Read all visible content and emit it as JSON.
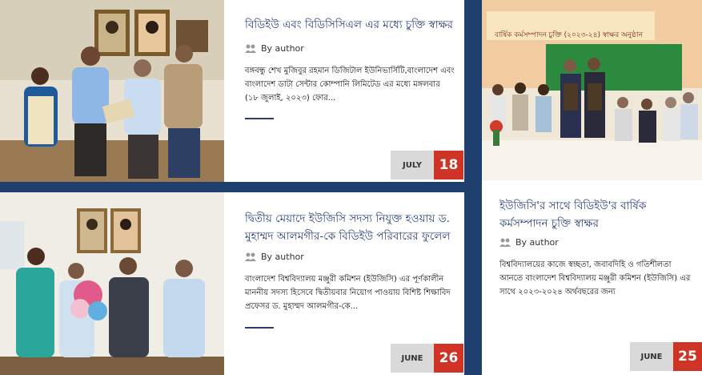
{
  "posts": [
    {
      "title": "বিডিইউ এবং বিডিসিসিএল এর মধ্যে চুক্তি স্বাক্ষর",
      "author": "By author",
      "excerpt": "বঙ্গবন্ধু শেখ মুজিবুর রহমান ডিজিটাল ইউনিভার্সিটি,বাংলাদেশ এবং বাংলাদেশ ডাটা সেন্টার কোম্পানি লিমিটেড এর মধ্যে মঙ্গলবার (১৮ জুলাই, ২০২৩) ফোর...",
      "month": "JULY",
      "day": "18"
    },
    {
      "banner_line": "বার্ষিক কর্মসম্পাদন চুক্তি (২০২৩-২৪) স্বাক্ষর অনুষ্ঠান",
      "title": "ইউজিসি'র সাথে বিডিইউ'র বার্ষিক কর্মসম্পাদন চুক্তি স্বাক্ষর",
      "author": "By author",
      "excerpt": "বিশ্ববিদ্যালয়ের কাজে স্বচ্ছতা, জবাবদিহি ও গতিশীলতা আনতে বাংলাদেশ বিশ্ববিদ্যালয় মঞ্জুরী কমিশন (ইউজিসি) এর সাথে ২০২৩-২০২৪ অর্থবছরের জন্য",
      "month": "JUNE",
      "day": "25"
    },
    {
      "title": "দ্বিতীয় মেয়াদে ইউজিসি সদস্য নিযুক্ত হওয়ায় ড. মুহাম্মদ আলমগীর-কে বিডিইউ পরিবারের ফুলেল",
      "author": "By author",
      "excerpt": "বাংলাদেশ বিশ্ববিদ্যালয় মঞ্জুরী কমিশন (ইউজিসি) এর পূর্ণকালীন মাননীয় সদস্য হিসেবে দ্বিতীয়বার নিয়োগ পাওয়ায় বিশিষ্ট শিক্ষাবিদ প্রফেসর ড. মুহাম্মদ আলমগীর-কে...",
      "month": "JUNE",
      "day": "26"
    }
  ],
  "colors": {
    "page_bg": "#1f3f6e",
    "title": "#2b3d73",
    "day_badge": "#cf3426",
    "month_badge": "#d9d9d9"
  }
}
